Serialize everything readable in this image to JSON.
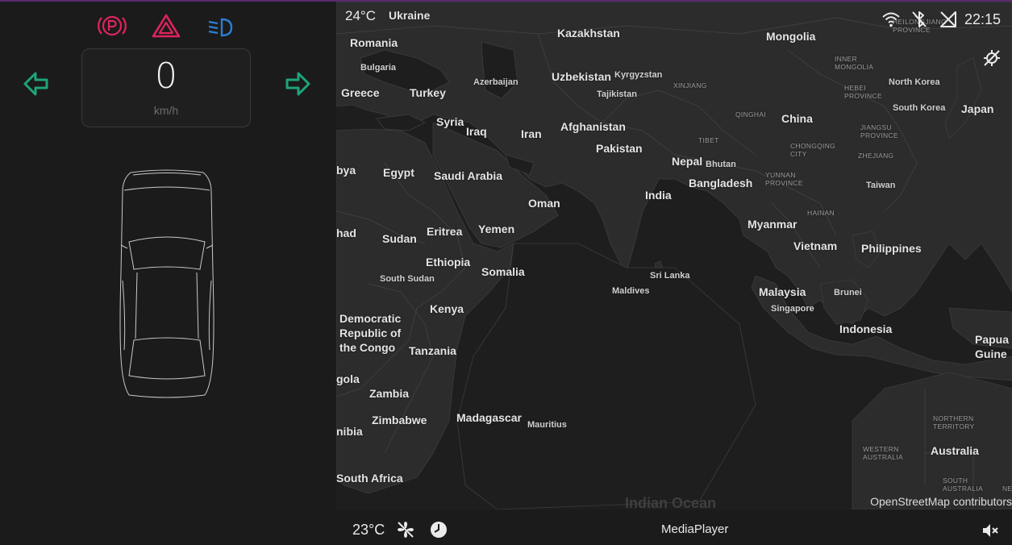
{
  "cluster": {
    "speed": "0",
    "speed_unit": "km/h",
    "telltales": [
      "parking-brake-icon",
      "hazard-warning-icon",
      "low-beam-icon"
    ],
    "colors": {
      "red": "#e0245e",
      "blue": "#2a7fd4",
      "green": "#1fa37a"
    }
  },
  "status": {
    "outside_temp": "24°C",
    "time": "22:15",
    "icons": [
      "wifi-icon",
      "bluetooth-off-icon",
      "no-signal-icon",
      "location-off-icon"
    ]
  },
  "map": {
    "attribution": "OpenStreetMap contributors",
    "labels": {
      "ukraine": "Ukraine",
      "kazakhstan": "Kazakhstan",
      "mongolia": "Mongolia",
      "romania": "Romania",
      "bulgaria": "Bulgaria",
      "greece": "Greece",
      "turkey": "Turkey",
      "azerbaijan": "Azerbaijan",
      "uzbekistan": "Uzbekistan",
      "kyrgyzstan": "Kyrgyzstan",
      "tajikistan": "Tajikistan",
      "xinjiang": "XINJIANG",
      "inner_mongolia": "INNER\nMONGOLIA",
      "heilongjiang": "HEILONGJIANG\nPROVINCE",
      "hebei": "HEBEI\nPROVINCE",
      "north_korea": "North Korea",
      "south_korea": "South Korea",
      "japan": "Japan",
      "syria": "Syria",
      "iraq": "Iraq",
      "iran": "Iran",
      "afghanistan": "Afghanistan",
      "qinghai": "QINGHAI",
      "china": "China",
      "pakistan": "Pakistan",
      "tibet": "TIBET",
      "jiangsu": "JIANGSU\nPROVINCE",
      "zhejiang": "ZHEJIANG",
      "chongqing": "CHONGQING\nCITY",
      "libya": "bya",
      "egypt": "Egypt",
      "saudi_arabia": "Saudi Arabia",
      "nepal": "Nepal",
      "bhutan": "Bhutan",
      "bangladesh": "Bangladesh",
      "yunnan": "YUNNAN\nPROVINCE",
      "taiwan": "Taiwan",
      "oman": "Oman",
      "india": "India",
      "hainan": "HAINAN",
      "chad": "had",
      "sudan": "Sudan",
      "eritrea": "Eritrea",
      "yemen": "Yemen",
      "myanmar": "Myanmar",
      "vietnam": "Vietnam",
      "philippines": "Philippines",
      "ethiopia": "Ethiopia",
      "somalia": "Somalia",
      "south_sudan": "South Sudan",
      "sri_lanka": "Sri Lanka",
      "maldives": "Maldives",
      "malaysia": "Malaysia",
      "brunei": "Brunei",
      "singapore": "Singapore",
      "drc": "Democratic\nRepublic of\nthe Congo",
      "kenya": "Kenya",
      "indonesia": "Indonesia",
      "papua": "Papua N\nGuine",
      "tanzania": "Tanzania",
      "angola": "gola",
      "zambia": "Zambia",
      "zimbabwe": "Zimbabwe",
      "madagascar": "Madagascar",
      "mauritius": "Mauritius",
      "namibia": "nibia",
      "northern_territory": "NORTHERN\nTERRITORY",
      "western_australia": "WESTERN\nAUSTRALIA",
      "australia": "Australia",
      "south_africa": "South Africa",
      "south_australia": "SOUTH\nAUSTRALIA",
      "nsw": "NEW",
      "indian_ocean": "Indian Ocean"
    }
  },
  "bottom": {
    "inside_temp": "23°C",
    "media": "MediaPlayer",
    "icons": [
      "fan-icon",
      "timer-icon",
      "mute-icon"
    ]
  }
}
